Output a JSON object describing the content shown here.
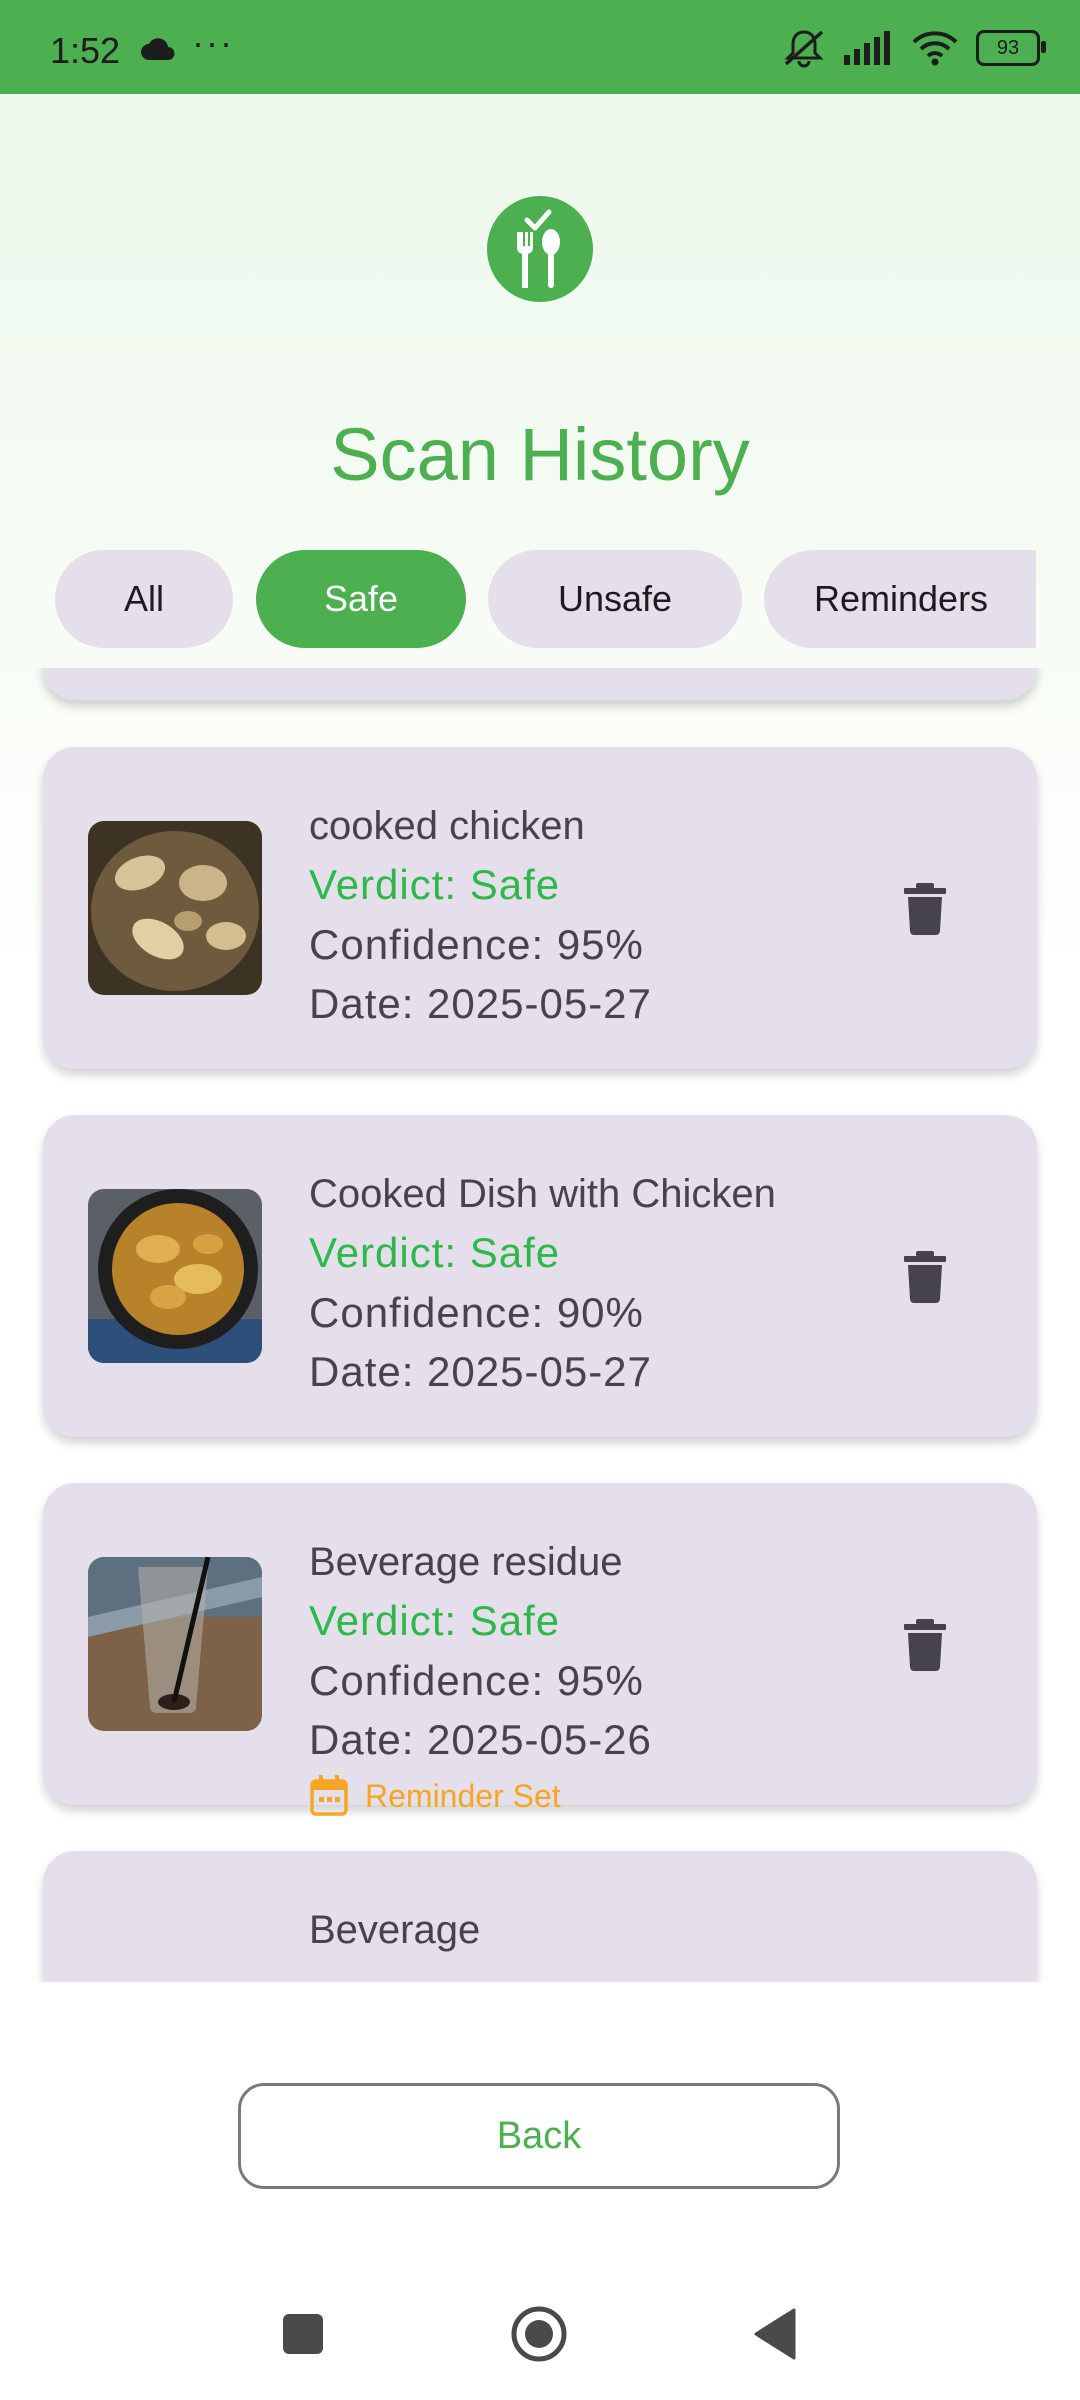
{
  "status_bar": {
    "time": "1:52",
    "more": "···",
    "battery": "93"
  },
  "page": {
    "title": "Scan History"
  },
  "filters": [
    {
      "label": "All",
      "active": false
    },
    {
      "label": "Safe",
      "active": true
    },
    {
      "label": "Unsafe",
      "active": false
    },
    {
      "label": "Reminders",
      "active": false
    }
  ],
  "scans": [
    {
      "name": "cooked chicken",
      "verdict": "Verdict: Safe",
      "confidence": "Confidence: 95%",
      "date": "Date: 2025-05-27",
      "reminder": null
    },
    {
      "name": "Cooked Dish with Chicken",
      "verdict": "Verdict: Safe",
      "confidence": "Confidence: 90%",
      "date": "Date: 2025-05-27",
      "reminder": null
    },
    {
      "name": "Beverage residue",
      "verdict": "Verdict: Safe",
      "confidence": "Confidence: 95%",
      "date": "Date: 2025-05-26",
      "reminder": "Reminder Set"
    },
    {
      "name": "Beverage",
      "verdict": "",
      "confidence": "",
      "date": "",
      "reminder": null
    }
  ],
  "back_button": {
    "label": "Back"
  },
  "colors": {
    "accent": "#4CAF50",
    "verdict_safe": "#2DB84A",
    "reminder": "#F5A623",
    "card": "#E4DFEA"
  }
}
